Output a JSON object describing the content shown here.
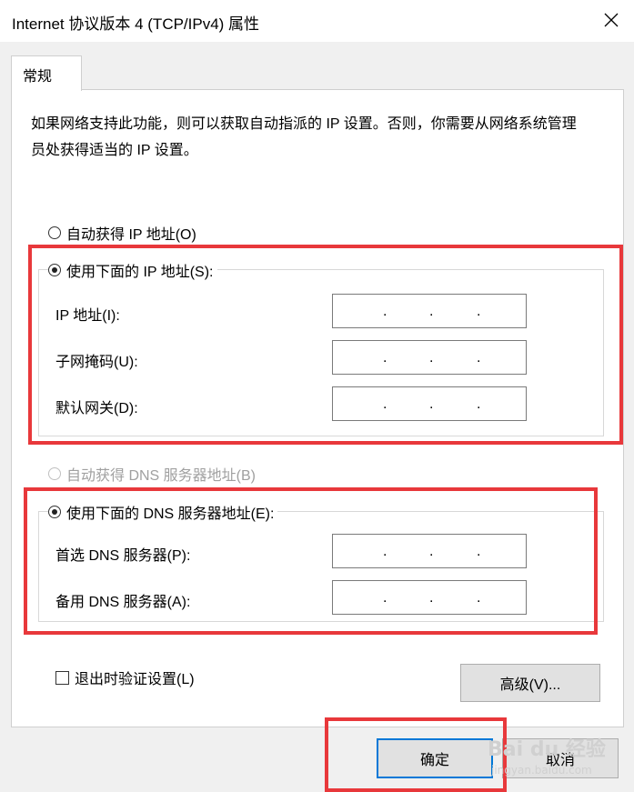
{
  "window": {
    "title": "Internet 协议版本 4 (TCP/IPv4) 属性"
  },
  "tabs": [
    {
      "label": "常规"
    }
  ],
  "description": "如果网络支持此功能，则可以获取自动指派的 IP 设置。否则，你需要从网络系统管理员处获得适当的 IP 设置。",
  "ip_mode": {
    "auto": {
      "label": "自动获得 IP 地址(O)",
      "checked": false
    },
    "manual": {
      "label": "使用下面的 IP 地址(S):",
      "checked": true
    }
  },
  "ip_fields": [
    {
      "label": "IP 地址(I):",
      "value": ". . ."
    },
    {
      "label": "子网掩码(U):",
      "value": ". . ."
    },
    {
      "label": "默认网关(D):",
      "value": ". . ."
    }
  ],
  "dns_mode": {
    "auto": {
      "label": "自动获得 DNS 服务器地址(B)",
      "checked": false,
      "disabled": true
    },
    "manual": {
      "label": "使用下面的 DNS 服务器地址(E):",
      "checked": true
    }
  },
  "dns_fields": [
    {
      "label": "首选 DNS 服务器(P):",
      "value": ". . ."
    },
    {
      "label": "备用 DNS 服务器(A):",
      "value": ". . ."
    }
  ],
  "validate": {
    "label": "退出时验证设置(L)",
    "checked": false
  },
  "buttons": {
    "advanced": "高级(V)...",
    "ok": "确定",
    "cancel": "取消"
  },
  "watermark": {
    "brand": "Bai du 经验",
    "url": "jingyan.baidu.com"
  },
  "colors": {
    "highlight": "#e8383b",
    "accent": "#0078d7"
  }
}
